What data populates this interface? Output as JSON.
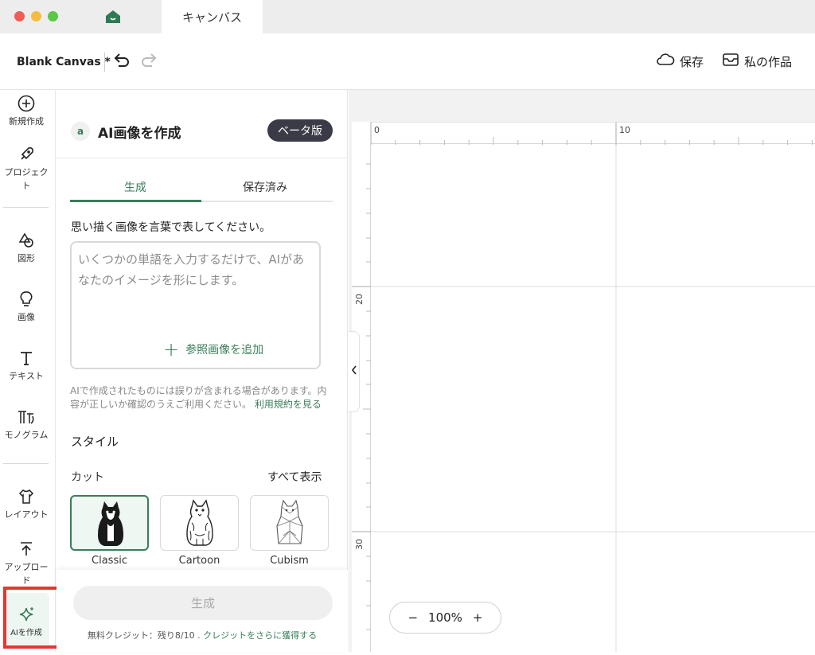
{
  "window": {
    "tab_label": "キャンバス"
  },
  "header": {
    "doc_title": "Blank Canvas *",
    "save_label": "保存",
    "my_works_label": "私の作品"
  },
  "rail": {
    "items": [
      {
        "label": "新規作成",
        "icon": "plus-circle-icon"
      },
      {
        "label": "プロジェクト",
        "icon": "rocket-icon"
      },
      {
        "label": "図形",
        "icon": "shapes-icon"
      },
      {
        "label": "画像",
        "icon": "lightbulb-icon"
      },
      {
        "label": "テキスト",
        "icon": "text-icon"
      },
      {
        "label": "モノグラム",
        "icon": "monogram-icon"
      },
      {
        "label": "レイアウト",
        "icon": "shirt-icon"
      },
      {
        "label": "アップロード",
        "icon": "upload-icon"
      },
      {
        "label": "AIを作成",
        "icon": "sparkle-icon"
      }
    ]
  },
  "panel": {
    "title": "AI画像を作成",
    "icon_letter": "a",
    "beta_label": "ベータ版",
    "tabs": [
      "生成",
      "保存済み"
    ],
    "prompt_label": "思い描く画像を言葉で表してください。",
    "prompt_placeholder": "いくつかの単語を入力するだけで、AIがあなたのイメージを形にします。",
    "prompt_value": "",
    "add_reference_label": "参照画像を追加",
    "disclaimer": "AIで作成されたものには誤りが含まれる場合があります。内容が正しいか確認のうえご利用ください。",
    "terms_link": "利用規約を見る",
    "style_heading": "スタイル",
    "cut_heading": "カット",
    "show_all": "すべて表示",
    "styles": [
      {
        "label": "Classic",
        "selected": true
      },
      {
        "label": "Cartoon",
        "selected": false
      },
      {
        "label": "Cubism",
        "selected": false
      }
    ],
    "generate_button": "生成",
    "credits_text": "無料クレジット：残り8/10 . ",
    "credits_link": "クレジットをさらに獲得する"
  },
  "canvas": {
    "ruler_top": [
      "0",
      "10"
    ],
    "ruler_left": [
      "20",
      "30"
    ],
    "zoom_minus": "−",
    "zoom_level": "100%",
    "zoom_plus": "+"
  },
  "colors": {
    "accent": "#3a7d5a",
    "highlight": "#e2382f",
    "beta_bg": "#3b3b47"
  }
}
